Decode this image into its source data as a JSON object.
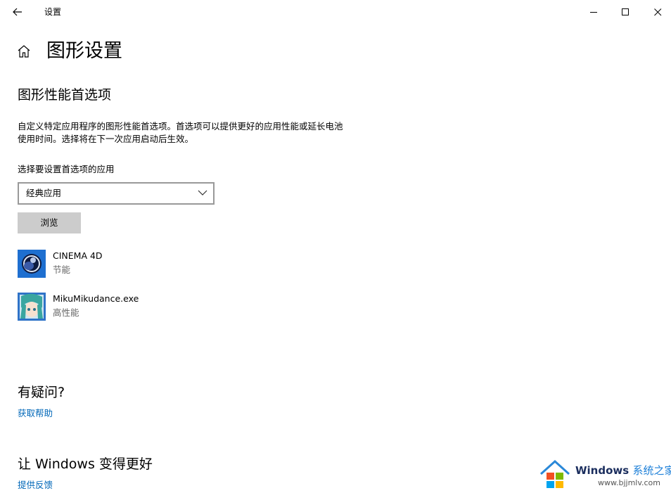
{
  "window": {
    "title": "设置"
  },
  "page": {
    "title": "图形设置"
  },
  "graphics": {
    "heading": "图形性能首选项",
    "description": "自定义特定应用程序的图形性能首选项。首选项可以提供更好的应用性能或延长电池使用时间。选择将在下一次应用启动后生效。",
    "select_label": "选择要设置首选项的应用",
    "app_type_selected": "经典应用",
    "browse_label": "浏览",
    "apps": [
      {
        "name": "CINEMA 4D",
        "preference": "节能",
        "icon": "cinema4d-icon"
      },
      {
        "name": "MikuMikudance.exe",
        "preference": "高性能",
        "icon": "mikumikudance-icon"
      }
    ]
  },
  "help": {
    "heading": "有疑问?",
    "link": "获取帮助"
  },
  "feedback": {
    "heading": "让 Windows 变得更好",
    "link": "提供反馈"
  },
  "watermark": {
    "brand": "Windows",
    "brand_cn": "系统之家",
    "url": "www.bjjmlv.com"
  },
  "colors": {
    "accent": "#0067b8",
    "button_bg": "#cccccc",
    "secondary_text": "#666666"
  }
}
